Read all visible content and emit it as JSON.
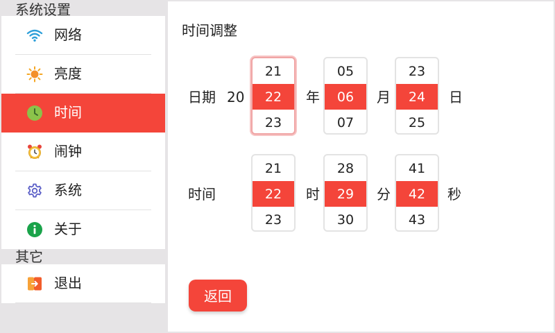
{
  "sidebar": {
    "section1_title": "系统设置",
    "section2_title": "其它",
    "items": [
      {
        "label": "网络",
        "icon": "wifi-icon"
      },
      {
        "label": "亮度",
        "icon": "sun-icon"
      },
      {
        "label": "时间",
        "icon": "clock-icon",
        "active": true
      },
      {
        "label": "闹钟",
        "icon": "alarm-clock-icon"
      },
      {
        "label": "系统",
        "icon": "gear-icon"
      },
      {
        "label": "关于",
        "icon": "info-icon"
      }
    ],
    "other_items": [
      {
        "label": "退出",
        "icon": "exit-icon"
      }
    ]
  },
  "main": {
    "title": "时间调整",
    "date": {
      "label": "日期",
      "year_prefix": "20",
      "year_unit": "年",
      "month_unit": "月",
      "day_unit": "日",
      "year": [
        "21",
        "22",
        "23"
      ],
      "month": [
        "05",
        "06",
        "07"
      ],
      "day": [
        "23",
        "24",
        "25"
      ]
    },
    "time": {
      "label": "时间",
      "hour_unit": "时",
      "minute_unit": "分",
      "second_unit": "秒",
      "hour": [
        "21",
        "22",
        "23"
      ],
      "minute": [
        "28",
        "29",
        "30"
      ],
      "second": [
        "41",
        "42",
        "43"
      ]
    },
    "back_label": "返回"
  },
  "colors": {
    "accent": "#f4453a",
    "focus_border": "#f0a4a4",
    "background": "#e6e4e6"
  }
}
